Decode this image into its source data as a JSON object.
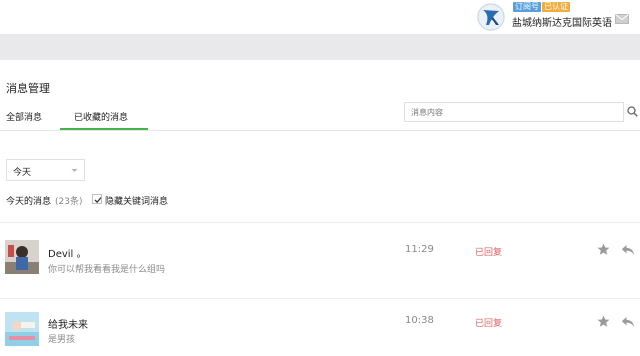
{
  "header": {
    "account_name": "盐城纳斯达克国际英语",
    "badges": {
      "subscription": "订阅号",
      "verified": "已认证"
    },
    "icons": {
      "logo": "brand-logo",
      "mail": "mail-icon"
    }
  },
  "page": {
    "title": "消息管理",
    "tabs": [
      {
        "label": "全部消息",
        "active": false
      },
      {
        "label": "已收藏的消息",
        "active": true
      }
    ],
    "search": {
      "placeholder": "消息内容",
      "value": ""
    }
  },
  "filter": {
    "date_selected": "今天",
    "summary_label": "今天的消息",
    "summary_count": "(23条)",
    "hide_keyword_label": "隐藏关键词消息",
    "hide_keyword_checked": true
  },
  "messages": [
    {
      "name": "Devil 。",
      "text": "你可以帮我看看我是什么组吗",
      "time": "11:29",
      "status": "已回复",
      "starred": false
    },
    {
      "name": "给我未来",
      "text": "是男孩",
      "time": "10:38",
      "status": "已回复",
      "starred": false
    }
  ],
  "colors": {
    "accent_green": "#44b549",
    "status_red": "#e15f63",
    "badge_blue": "#5a9fdc",
    "badge_orange": "#f0ad3e"
  }
}
